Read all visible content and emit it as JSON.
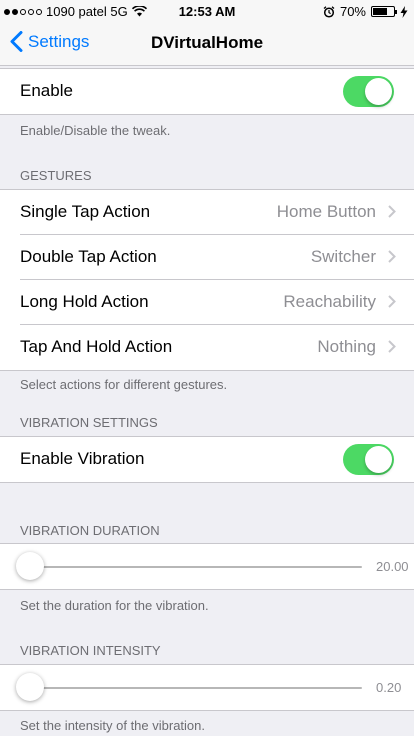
{
  "status": {
    "carrier": "1090 patel 5G",
    "time": "12:53 AM",
    "battery": "70%",
    "battery_level": 0.7
  },
  "nav": {
    "back_label": "Settings",
    "title": "DVirtualHome"
  },
  "main": {
    "enable_label": "Enable",
    "enable_on": true,
    "enable_footer": "Enable/Disable the tweak.",
    "gestures_header": "GESTURES",
    "gestures": [
      {
        "label": "Single Tap Action",
        "value": "Home Button"
      },
      {
        "label": "Double Tap Action",
        "value": "Switcher"
      },
      {
        "label": "Long Hold Action",
        "value": "Reachability"
      },
      {
        "label": "Tap And Hold Action",
        "value": "Nothing"
      }
    ],
    "gestures_footer": "Select actions for different gestures.",
    "vibration_header": "VIBRATION SETTINGS",
    "vibration_label": "Enable Vibration",
    "vibration_on": true,
    "duration_header": "VIBRATION DURATION",
    "duration_value": "20.00",
    "duration_level": 0.0,
    "duration_footer": "Set the duration for the vibration.",
    "intensity_header": "VIBRATION INTENSITY",
    "intensity_value": "0.20",
    "intensity_level": 0.0,
    "intensity_footer": "Set the intensity of the vibration."
  },
  "colors": {
    "accent": "#007aff",
    "switch_on": "#4cd964"
  }
}
